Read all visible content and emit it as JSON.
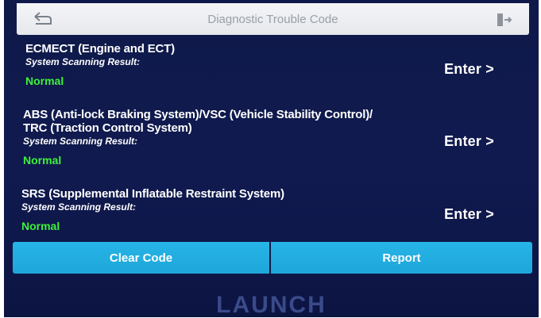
{
  "header": {
    "title": "Diagnostic Trouble Code",
    "back_icon": "back-arrow-icon",
    "exit_icon": "exit-icon"
  },
  "systems": [
    {
      "name_line1": "ECMECT (Engine and ECT)",
      "name_line2": "",
      "result_label": "System Scanning Result:",
      "status": "Normal",
      "enter_label": "Enter >"
    },
    {
      "name_line1": "ABS (Anti-lock Braking System)/VSC (Vehicle Stability Control)/",
      "name_line2": "TRC (Traction Control System)",
      "result_label": "System Scanning Result:",
      "status": "Normal",
      "enter_label": "Enter >"
    },
    {
      "name_line1": "SRS (Supplemental Inflatable Restraint System)",
      "name_line2": "",
      "result_label": "System Scanning Result:",
      "status": "Normal",
      "enter_label": "Enter >"
    }
  ],
  "actions": {
    "clear_code_label": "Clear Code",
    "report_label": "Report"
  },
  "brand": "LAUNCH",
  "colors": {
    "background": "#101a4f",
    "status_normal": "#3df23a",
    "button": "#22ace0"
  }
}
